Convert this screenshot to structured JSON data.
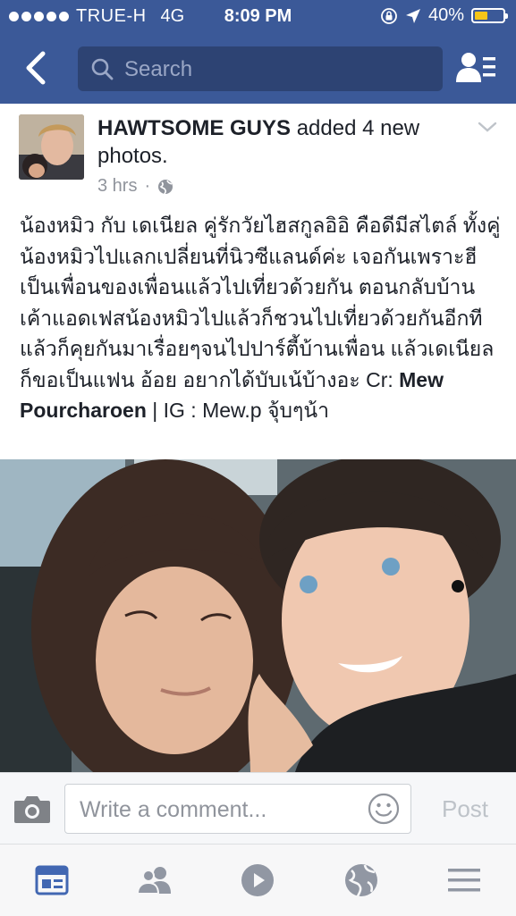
{
  "status_bar": {
    "carrier": "TRUE-H",
    "network": "4G",
    "time": "8:09 PM",
    "battery": "40%",
    "battery_level": 0.4,
    "battery_color": "#f5c518"
  },
  "nav": {
    "back_icon": "chevron-left-icon",
    "search_placeholder": "Search",
    "friends_icon": "friend-requests-icon"
  },
  "post": {
    "author": "HAWTSOME GUYS",
    "action": "added 4 new photos.",
    "time": "3 hrs",
    "privacy_icon": "globe-icon",
    "text_1": "น้องหมิว กับ เดเนียล คู่รักวัยไฮสกูลอิอิ คือดีมีสไตล์ ทั้งคู่ น้องหมิวไปแลกเปลี่ยนที่นิวซีแลนด์ค่ะ เจอกันเพราะฮีเป็นเพื่อนของเพื่อนแล้วไปเที่ยวด้วยกัน ตอนกลับบ้านเค้าแอดเฟสน้องหมิวไปแล้วก็ชวนไปเที่ยวด้วยกันอีกทีแล้วก็คุยกันมาเรื่อยๆจนไปปาร์ตี้บ้านเพื่อน แล้วเดเนียลก็ขอเป็นแฟน อ้อย อยากได้บับเน้บ้างอะ Cr: ",
    "credit_name": "Mew Pourcharoen",
    "text_2": " | IG : Mew.p จุ้บๆน้า"
  },
  "comment": {
    "placeholder": "Write a comment...",
    "post_label": "Post"
  },
  "tabs": [
    {
      "icon": "news-feed-icon",
      "active": true
    },
    {
      "icon": "friends-icon",
      "active": false
    },
    {
      "icon": "video-icon",
      "active": false
    },
    {
      "icon": "notifications-globe-icon",
      "active": false
    },
    {
      "icon": "menu-icon",
      "active": false
    }
  ],
  "colors": {
    "brand_blue": "#3b5998",
    "search_bg": "#2d4373",
    "active_tab": "#4267b2",
    "inactive_tab": "#9197a3"
  }
}
